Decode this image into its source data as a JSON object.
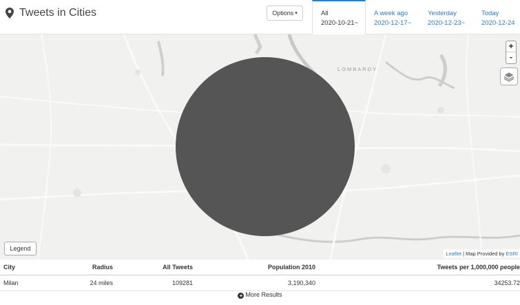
{
  "header": {
    "title": "Tweets in Cities",
    "options_label": "Options",
    "tabs": [
      {
        "label": "All",
        "date": "2020-10-21~"
      },
      {
        "label": "A week ago",
        "date": "2020-12-17~"
      },
      {
        "label": "Yesterday",
        "date": "2020-12-23~"
      },
      {
        "label": "Today",
        "date": "2020-12-24"
      }
    ]
  },
  "map": {
    "region_label": "LOMBARDY",
    "zoom_in": "+",
    "zoom_out": "-",
    "legend_label": "Legend",
    "attribution_link": "Leaflet",
    "attribution_text": " | Map Provided by ",
    "attribution_provider": "ESRI",
    "circle_color": "#555555"
  },
  "table": {
    "headers": {
      "city": "City",
      "radius": "Radius",
      "all_tweets": "All Tweets",
      "population": "Population 2010",
      "rate": "Tweets per 1,000,000 people"
    },
    "rows": [
      {
        "city": "Milan",
        "radius": "24 miles",
        "all_tweets": "109281",
        "population": "3,190,340",
        "rate": "34253.72"
      }
    ],
    "more_label": "More Results"
  },
  "colors": {
    "accent": "#337ab7",
    "map_bg": "#f1f1f0"
  }
}
